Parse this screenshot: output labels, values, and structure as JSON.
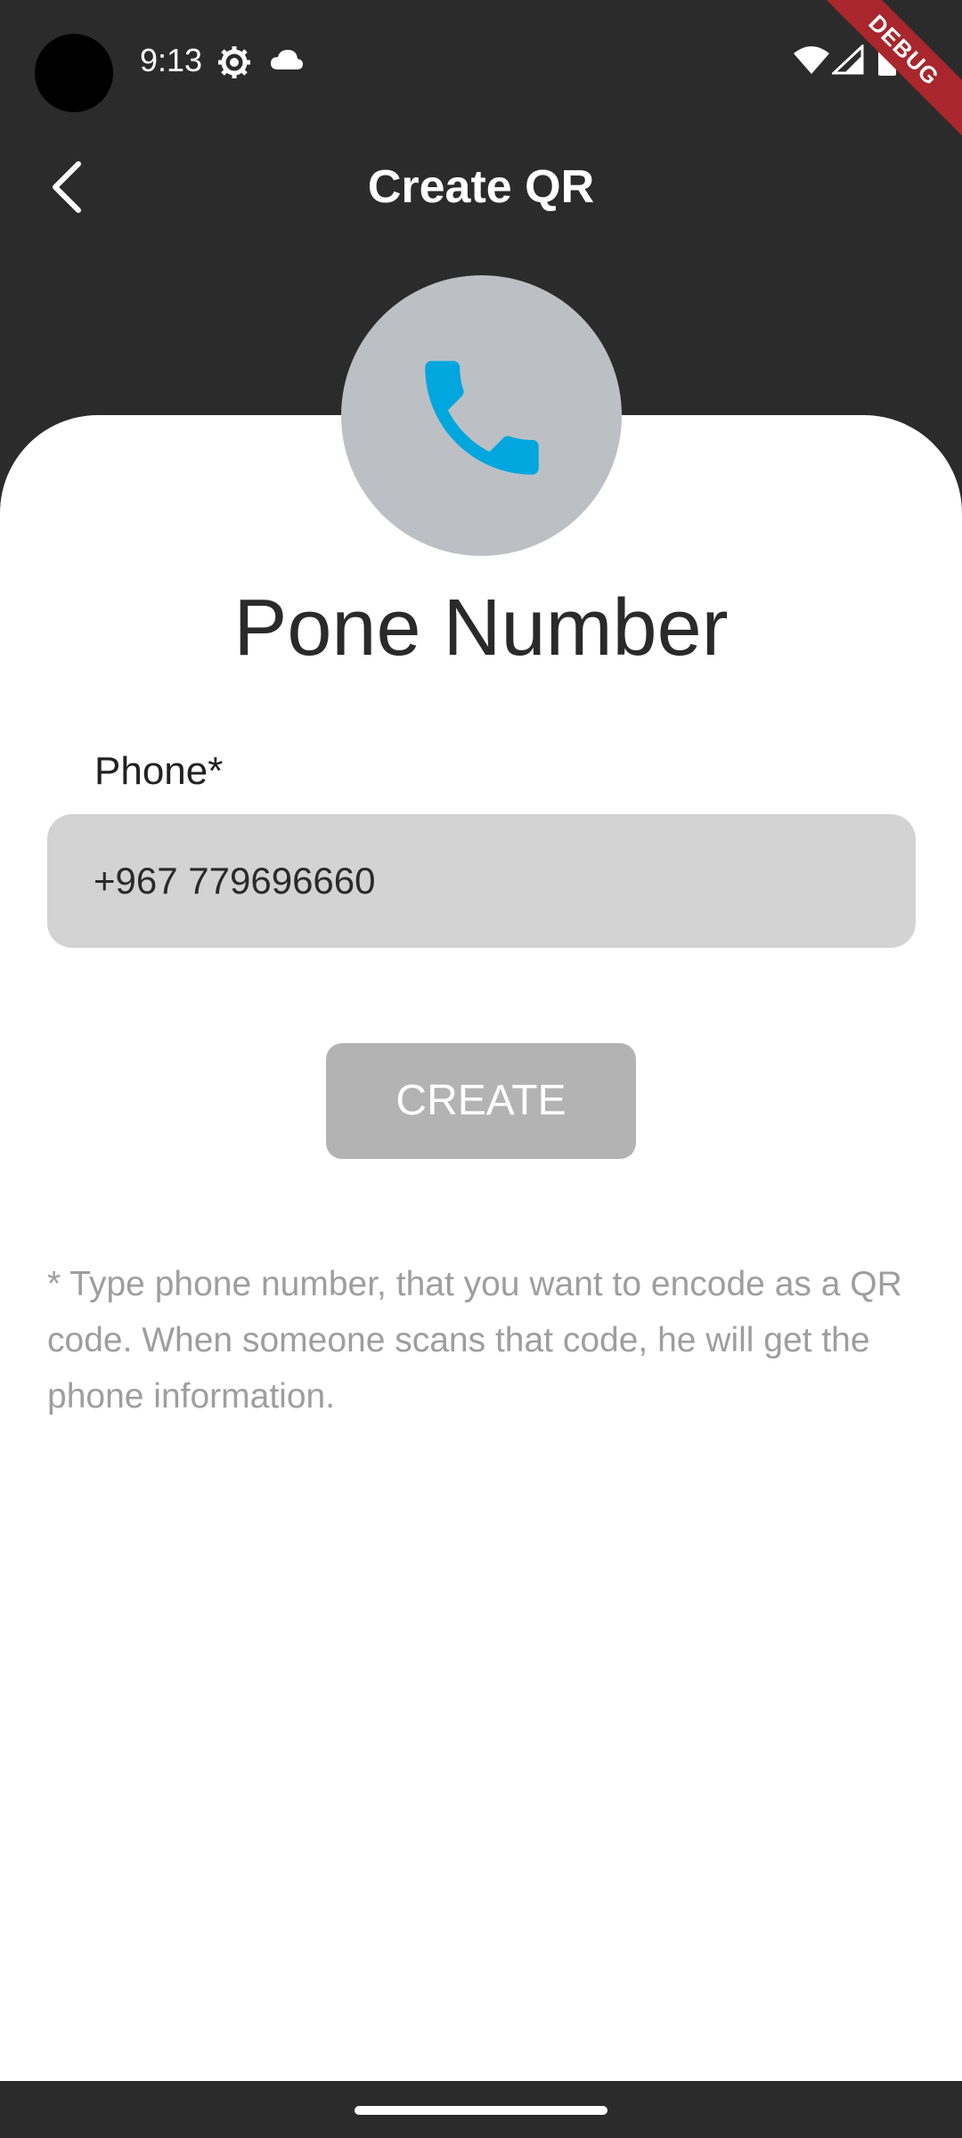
{
  "status_bar": {
    "time": "9:13",
    "debug_label": "DEBUG"
  },
  "app_bar": {
    "title": "Create QR",
    "back_icon": "chevron-left-icon"
  },
  "content": {
    "header_icon": "phone-icon",
    "section_title": "Pone Number",
    "phone_field": {
      "label": "Phone*",
      "value": "+967 779696660"
    },
    "create_button_label": "CREATE",
    "hint": "* Type phone number, that you want to encode as a QR code. When someone scans that code, he will get the phone information."
  },
  "colors": {
    "app_bar_background": "#2b2b2c",
    "card_background": "#ffffff",
    "icon_circle": "#bcc0c4",
    "phone_icon": "#00a6de",
    "input_background": "#d3d3d4",
    "button_disabled": "#b3b3b3",
    "hint_text": "#9e9e9e",
    "debug_banner": "#a8262c"
  }
}
